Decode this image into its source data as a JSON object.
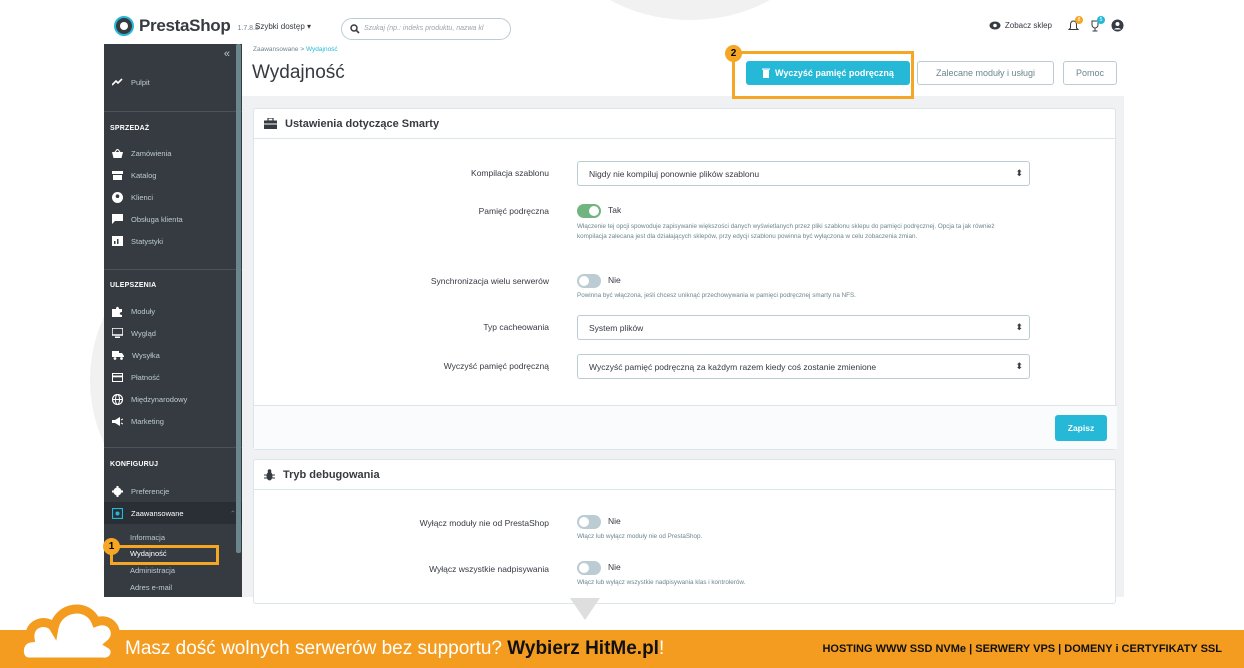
{
  "topbar": {
    "logo": "PrestaShop",
    "version": "1.7.8.8",
    "quick_access": "Szybki dostęp ▾",
    "search_placeholder": "Szukaj (np.: indeks produktu, nazwa kl",
    "view_shop": "Zobacz sklep",
    "notif_count": "8",
    "trophy_count": "5"
  },
  "sidebar": {
    "dashboard": "Pulpit",
    "sections": [
      {
        "title": "SPRZEDAŻ",
        "items": [
          "Zamówienia",
          "Katalog",
          "Klienci",
          "Obsługa klienta",
          "Statystyki"
        ]
      },
      {
        "title": "ULEPSZENIA",
        "items": [
          "Moduły",
          "Wygląd",
          "Wysyłka",
          "Płatność",
          "Międzynarodowy",
          "Marketing"
        ]
      },
      {
        "title": "KONFIGURUJ",
        "items": [
          "Preferencje",
          "Zaawansowane"
        ]
      }
    ],
    "submenu": [
      "Informacja",
      "Wydajność",
      "Administracja",
      "Adres e-mail"
    ]
  },
  "header": {
    "breadcrumb_parent": "Zaawansowane",
    "breadcrumb_sep": " > ",
    "breadcrumb_current": "Wydajność",
    "title": "Wydajność",
    "btn_clear_cache": "Wyczyść pamięć podręczną",
    "btn_recommended": "Zalecane moduły i usługi",
    "btn_help": "Pomoc"
  },
  "smarty": {
    "title": "Ustawienia dotyczące Smarty",
    "compile_label": "Kompilacja szablonu",
    "compile_value": "Nigdy nie kompiluj ponownie plików szablonu",
    "cache_label": "Pamięć podręczna",
    "cache_value": "Tak",
    "cache_help": "Włączenie tej opcji spowoduje zapisywanie większości danych wyświetlanych przez pliki szablonu sklepu do pamięci podręcznej. Opcja ta jak również kompilacja zalecana jest dla działających sklepów, przy edycji szablonu powinna być wyłączona w celu zobaczenia zmian.",
    "multi_label": "Synchronizacja wielu serwerów",
    "multi_value": "Nie",
    "multi_help": "Powinna być włączona, jeśli chcesz uniknąć przechowywania w pamięci podręcznej smarty na NFS.",
    "type_label": "Typ cacheowania",
    "type_value": "System plików",
    "clear_label": "Wyczyść pamięć podręczną",
    "clear_value": "Wyczyść pamięć podręczną za każdym razem kiedy coś zostanie zmienione",
    "save": "Zapisz"
  },
  "debug": {
    "title": "Tryb debugowania",
    "nonps_label": "Wyłącz moduły nie od PrestaShop",
    "nonps_value": "Nie",
    "nonps_help": "Włącz lub wyłącz moduły nie od PrestaShop.",
    "overrides_label": "Wyłącz wszystkie nadpisywania",
    "overrides_value": "Nie",
    "overrides_help": "Włącz lub wyłącz wszystkie nadpisywania klas i kontrolerów."
  },
  "markers": {
    "one": "1",
    "two": "2"
  },
  "footer": {
    "lead": "Masz dość wolnych serwerów bez supportu? ",
    "brand": "Wybierz HitMe.pl",
    "bang": "!",
    "right": "HOSTING WWW SSD NVMe | SERWERY VPS | DOMENY i CERTYFIKATY SSL"
  },
  "colors": {
    "accent": "#25b9d7",
    "sidebar": "#363a41",
    "highlight": "#f4a624",
    "footer": "#f39c1f",
    "toggle_on": "#70b580"
  }
}
